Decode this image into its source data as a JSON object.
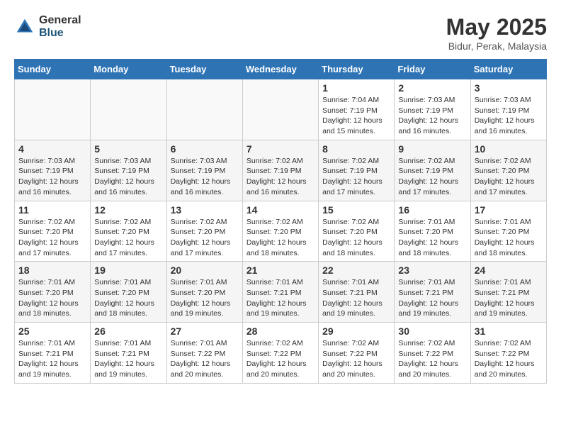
{
  "logo": {
    "general": "General",
    "blue": "Blue"
  },
  "title": "May 2025",
  "location": "Bidur, Perak, Malaysia",
  "days_header": [
    "Sunday",
    "Monday",
    "Tuesday",
    "Wednesday",
    "Thursday",
    "Friday",
    "Saturday"
  ],
  "weeks": [
    {
      "shaded": false,
      "days": [
        {
          "number": "",
          "info": ""
        },
        {
          "number": "",
          "info": ""
        },
        {
          "number": "",
          "info": ""
        },
        {
          "number": "",
          "info": ""
        },
        {
          "number": "1",
          "info": "Sunrise: 7:04 AM\nSunset: 7:19 PM\nDaylight: 12 hours\nand 15 minutes."
        },
        {
          "number": "2",
          "info": "Sunrise: 7:03 AM\nSunset: 7:19 PM\nDaylight: 12 hours\nand 16 minutes."
        },
        {
          "number": "3",
          "info": "Sunrise: 7:03 AM\nSunset: 7:19 PM\nDaylight: 12 hours\nand 16 minutes."
        }
      ]
    },
    {
      "shaded": true,
      "days": [
        {
          "number": "4",
          "info": "Sunrise: 7:03 AM\nSunset: 7:19 PM\nDaylight: 12 hours\nand 16 minutes."
        },
        {
          "number": "5",
          "info": "Sunrise: 7:03 AM\nSunset: 7:19 PM\nDaylight: 12 hours\nand 16 minutes."
        },
        {
          "number": "6",
          "info": "Sunrise: 7:03 AM\nSunset: 7:19 PM\nDaylight: 12 hours\nand 16 minutes."
        },
        {
          "number": "7",
          "info": "Sunrise: 7:02 AM\nSunset: 7:19 PM\nDaylight: 12 hours\nand 16 minutes."
        },
        {
          "number": "8",
          "info": "Sunrise: 7:02 AM\nSunset: 7:19 PM\nDaylight: 12 hours\nand 17 minutes."
        },
        {
          "number": "9",
          "info": "Sunrise: 7:02 AM\nSunset: 7:19 PM\nDaylight: 12 hours\nand 17 minutes."
        },
        {
          "number": "10",
          "info": "Sunrise: 7:02 AM\nSunset: 7:20 PM\nDaylight: 12 hours\nand 17 minutes."
        }
      ]
    },
    {
      "shaded": false,
      "days": [
        {
          "number": "11",
          "info": "Sunrise: 7:02 AM\nSunset: 7:20 PM\nDaylight: 12 hours\nand 17 minutes."
        },
        {
          "number": "12",
          "info": "Sunrise: 7:02 AM\nSunset: 7:20 PM\nDaylight: 12 hours\nand 17 minutes."
        },
        {
          "number": "13",
          "info": "Sunrise: 7:02 AM\nSunset: 7:20 PM\nDaylight: 12 hours\nand 17 minutes."
        },
        {
          "number": "14",
          "info": "Sunrise: 7:02 AM\nSunset: 7:20 PM\nDaylight: 12 hours\nand 18 minutes."
        },
        {
          "number": "15",
          "info": "Sunrise: 7:02 AM\nSunset: 7:20 PM\nDaylight: 12 hours\nand 18 minutes."
        },
        {
          "number": "16",
          "info": "Sunrise: 7:01 AM\nSunset: 7:20 PM\nDaylight: 12 hours\nand 18 minutes."
        },
        {
          "number": "17",
          "info": "Sunrise: 7:01 AM\nSunset: 7:20 PM\nDaylight: 12 hours\nand 18 minutes."
        }
      ]
    },
    {
      "shaded": true,
      "days": [
        {
          "number": "18",
          "info": "Sunrise: 7:01 AM\nSunset: 7:20 PM\nDaylight: 12 hours\nand 18 minutes."
        },
        {
          "number": "19",
          "info": "Sunrise: 7:01 AM\nSunset: 7:20 PM\nDaylight: 12 hours\nand 18 minutes."
        },
        {
          "number": "20",
          "info": "Sunrise: 7:01 AM\nSunset: 7:20 PM\nDaylight: 12 hours\nand 19 minutes."
        },
        {
          "number": "21",
          "info": "Sunrise: 7:01 AM\nSunset: 7:21 PM\nDaylight: 12 hours\nand 19 minutes."
        },
        {
          "number": "22",
          "info": "Sunrise: 7:01 AM\nSunset: 7:21 PM\nDaylight: 12 hours\nand 19 minutes."
        },
        {
          "number": "23",
          "info": "Sunrise: 7:01 AM\nSunset: 7:21 PM\nDaylight: 12 hours\nand 19 minutes."
        },
        {
          "number": "24",
          "info": "Sunrise: 7:01 AM\nSunset: 7:21 PM\nDaylight: 12 hours\nand 19 minutes."
        }
      ]
    },
    {
      "shaded": false,
      "days": [
        {
          "number": "25",
          "info": "Sunrise: 7:01 AM\nSunset: 7:21 PM\nDaylight: 12 hours\nand 19 minutes."
        },
        {
          "number": "26",
          "info": "Sunrise: 7:01 AM\nSunset: 7:21 PM\nDaylight: 12 hours\nand 19 minutes."
        },
        {
          "number": "27",
          "info": "Sunrise: 7:01 AM\nSunset: 7:22 PM\nDaylight: 12 hours\nand 20 minutes."
        },
        {
          "number": "28",
          "info": "Sunrise: 7:02 AM\nSunset: 7:22 PM\nDaylight: 12 hours\nand 20 minutes."
        },
        {
          "number": "29",
          "info": "Sunrise: 7:02 AM\nSunset: 7:22 PM\nDaylight: 12 hours\nand 20 minutes."
        },
        {
          "number": "30",
          "info": "Sunrise: 7:02 AM\nSunset: 7:22 PM\nDaylight: 12 hours\nand 20 minutes."
        },
        {
          "number": "31",
          "info": "Sunrise: 7:02 AM\nSunset: 7:22 PM\nDaylight: 12 hours\nand 20 minutes."
        }
      ]
    }
  ]
}
